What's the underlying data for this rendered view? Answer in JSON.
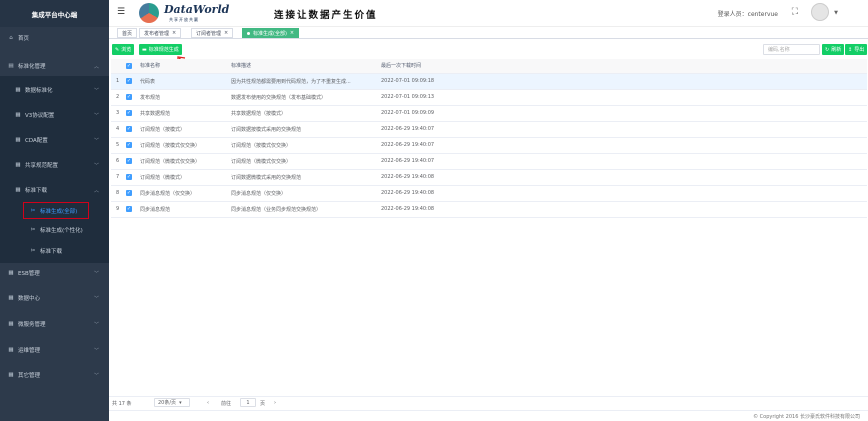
{
  "sidebar": {
    "title": "集成平台中心端",
    "items": [
      {
        "label": "首页",
        "icon": "home-icon"
      },
      {
        "label": "标准化管理",
        "icon": "standard-icon"
      },
      {
        "label": "数据标准化",
        "icon": "data-icon"
      },
      {
        "label": "V3协议配置",
        "icon": "protocol-icon"
      },
      {
        "label": "CDA配置",
        "icon": "cda-icon"
      },
      {
        "label": "共享规范配置",
        "icon": "share-icon"
      },
      {
        "label": "标准下载",
        "icon": "download-icon"
      },
      {
        "label": "标准生成(全部)",
        "icon": "tool-icon"
      },
      {
        "label": "标准生成(个性化)",
        "icon": "tool-icon"
      },
      {
        "label": "标准下载",
        "icon": "tool-icon"
      },
      {
        "label": "ESB管理",
        "icon": "esb-icon"
      },
      {
        "label": "数据中心",
        "icon": "datacenter-icon"
      },
      {
        "label": "微服务管理",
        "icon": "microservice-icon"
      },
      {
        "label": "运维管理",
        "icon": "ops-icon"
      },
      {
        "label": "其它管理",
        "icon": "other-icon"
      }
    ]
  },
  "header": {
    "logo": "DataWorld",
    "logo_sub": "共享开放共赢",
    "slogan": "连接让数据产生价值",
    "login_label": "登录人员：centervue"
  },
  "tags": [
    {
      "label": "首页"
    },
    {
      "label": "发布者管理"
    },
    {
      "label": "订阅者管理"
    },
    {
      "label": "标准生成(全部)"
    }
  ],
  "toolbar": {
    "browse_label": "浏览",
    "generate_label": "标准规范生成",
    "search_placeholder": "编码,名称",
    "refresh_label": "刷新",
    "export_label": "导出"
  },
  "table": {
    "headers": [
      "",
      "标准名称",
      "标准描述",
      "最后一次下载时间"
    ],
    "rows": [
      {
        "idx": "1",
        "name": "代码表",
        "desc": "因为共性规范都需要用到代码规范，为了不重复生成...",
        "time": "2022-07-01 09:09:18"
      },
      {
        "idx": "2",
        "name": "发布规范",
        "desc": "数据发布使用的交换规范（发布基础模式）",
        "time": "2022-07-01 09:09:13"
      },
      {
        "idx": "3",
        "name": "共享数据规范",
        "desc": "共享数据规范（按模式）",
        "time": "2022-07-01 09:09:09"
      },
      {
        "idx": "4",
        "name": "订阅规范（按模式）",
        "desc": "订阅数据按模式采用的交换规范",
        "time": "2022-06-29 19:40:07"
      },
      {
        "idx": "5",
        "name": "订阅规范（按模式仅交换）",
        "desc": "订阅规范（按模式仅交换）",
        "time": "2022-06-29 19:40:07"
      },
      {
        "idx": "6",
        "name": "订阅规范（微模式仅交换）",
        "desc": "订阅规范（微模式仅交换）",
        "time": "2022-06-29 19:40:07"
      },
      {
        "idx": "7",
        "name": "订阅规范（微模式）",
        "desc": "订阅数据微模式采用的交换规范",
        "time": "2022-06-29 19:40:08"
      },
      {
        "idx": "8",
        "name": "同步消息规范（仅交换）",
        "desc": "同步消息规范（仅交换）",
        "time": "2022-06-29 19:40:08"
      },
      {
        "idx": "9",
        "name": "同步消息规范",
        "desc": "同步消息规范（业务同步规范交换规范）",
        "time": "2022-06-29 19:40:08"
      }
    ]
  },
  "pager": {
    "total": "共 17 条",
    "size": "20条/页",
    "goto": "前往",
    "page": "1",
    "page_unit": "页"
  },
  "footer": "© Copyright 2016 长沙豪氏软件科技有限公司",
  "colors": {
    "sidebar": "#2d3a4b",
    "accent": "#13ce66",
    "selected": "#409eff"
  }
}
